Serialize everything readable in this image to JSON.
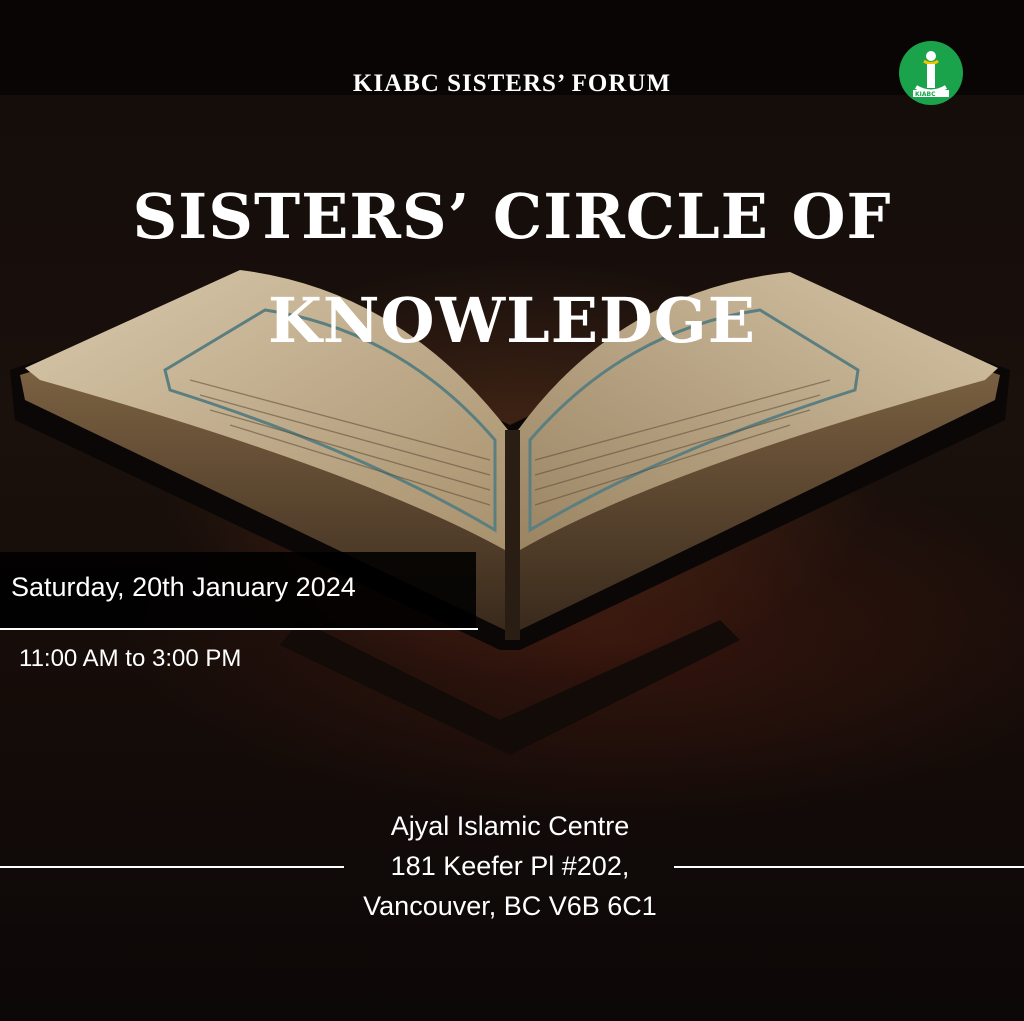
{
  "header": {
    "forum_title": "KIABC SISTERS’ FORUM",
    "logo_letters": "KIABC"
  },
  "event": {
    "title_line1": "SISTERS’ CIRCLE OF",
    "title_line2": "KNOWLEDGE",
    "date": "Saturday, 20th January 2024",
    "time": "11:00 AM to 3:00 PM"
  },
  "venue": {
    "name": "Ajyal Islamic Centre",
    "address_line1": "181 Keefer Pl #202,",
    "address_line2": "Vancouver, BC V6B 6C1"
  },
  "colors": {
    "text": "#ffffff",
    "logo_green": "#1aa34a",
    "background": "#140d0a"
  }
}
